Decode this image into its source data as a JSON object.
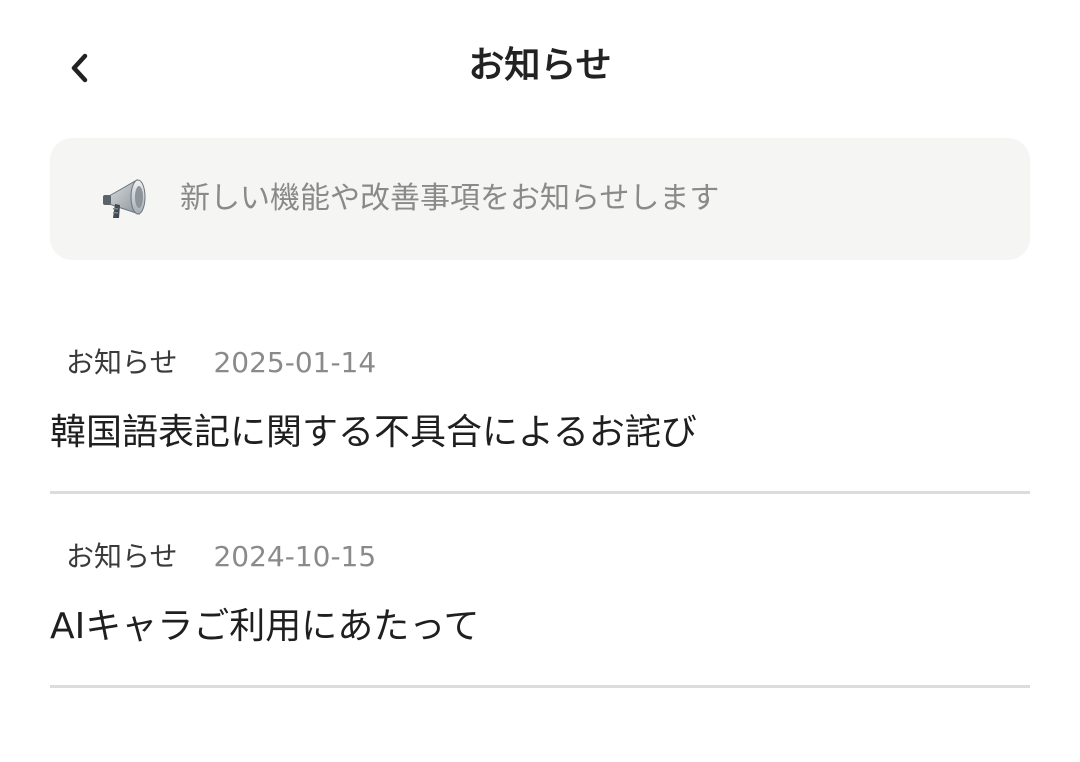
{
  "header": {
    "title": "お知らせ",
    "back_icon": "chevron-left-icon"
  },
  "banner": {
    "icon": "megaphone-icon",
    "text": "新しい機能や改善事項をお知らせします"
  },
  "notices": [
    {
      "category": "お知らせ",
      "date": "2025-01-14",
      "title": "韓国語表記に関する不具合によるお詫び"
    },
    {
      "category": "お知らせ",
      "date": "2024-10-15",
      "title": "AIキャラご利用にあたって"
    }
  ],
  "colors": {
    "background": "#ffffff",
    "banner_bg": "#f5f5f4",
    "muted_text": "#8a8a88",
    "divider": "#dcdcdc"
  }
}
